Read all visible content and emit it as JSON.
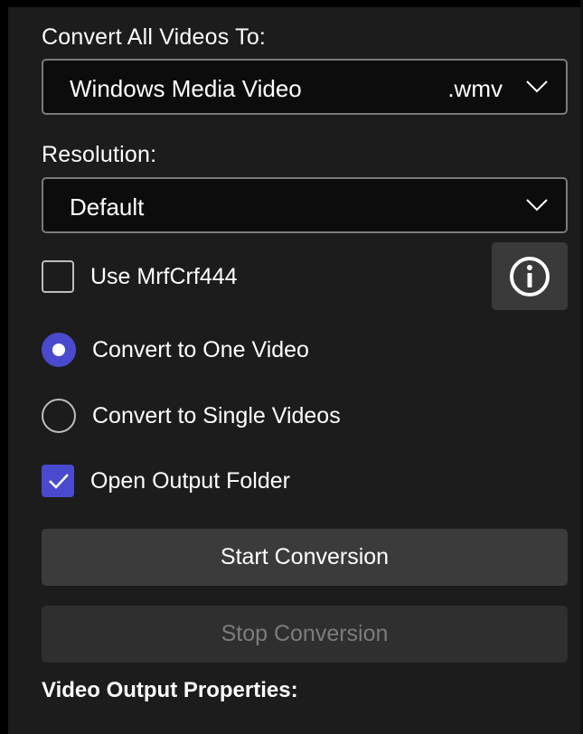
{
  "convert_to": {
    "label": "Convert All Videos To:",
    "selected_format": "Windows Media Video",
    "selected_extension": ".wmv",
    "icon": "chevron-down-icon"
  },
  "resolution": {
    "label": "Resolution:",
    "selected": "Default",
    "icon": "chevron-down-icon"
  },
  "options": {
    "use_mrfcrf444": {
      "label": "Use MrfCrf444",
      "checked": false
    },
    "info_icon": "info-icon",
    "convert_one": {
      "label": "Convert to One Video",
      "selected": true
    },
    "convert_single": {
      "label": "Convert to Single Videos",
      "selected": false
    },
    "open_output_folder": {
      "label": "Open Output Folder",
      "checked": true
    }
  },
  "actions": {
    "start_label": "Start Conversion",
    "stop_label": "Stop Conversion"
  },
  "properties": {
    "title": "Video Output Properties:"
  },
  "colors": {
    "accent": "#4a4acf",
    "panel_bg": "#1c1c1c",
    "combo_bg": "#0c0c0c",
    "button_bg": "#3b3b3b",
    "disabled_text": "#7c7c7c"
  }
}
